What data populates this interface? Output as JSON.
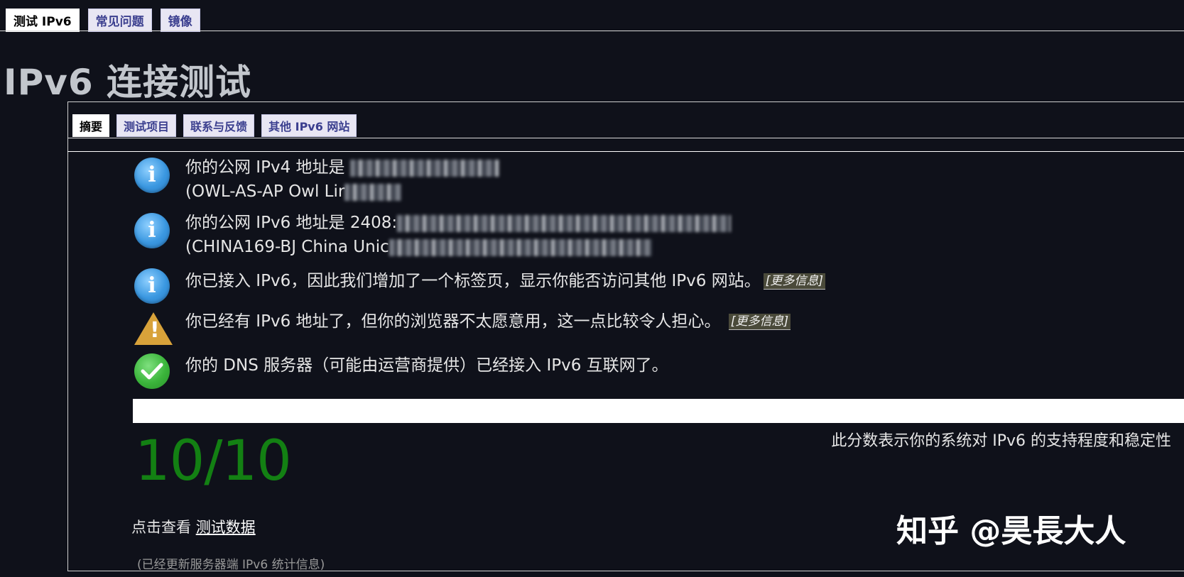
{
  "top_tabs": [
    {
      "label": "测试 IPv6",
      "active": true
    },
    {
      "label": "常见问题",
      "active": false
    },
    {
      "label": "镜像",
      "active": false
    }
  ],
  "page_title": "IPv6 连接测试",
  "sub_tabs": [
    {
      "label": "摘要",
      "active": true
    },
    {
      "label": "测试项目",
      "active": false
    },
    {
      "label": "联系与反馈",
      "active": false
    },
    {
      "label": "其他 IPv6 网站",
      "active": false
    }
  ],
  "info_rows": [
    {
      "icon": "info-icon",
      "line1": "你的公网 IPv4 地址是 ",
      "line2": "(OWL-AS-AP Owl Lir"
    },
    {
      "icon": "info-icon",
      "line1": "你的公网 IPv6 地址是 2408:",
      "line2": "(CHINA169-BJ China Unic"
    },
    {
      "icon": "info-icon",
      "text": "你已接入 IPv6，因此我们增加了一个标签页，显示你能否访问其他 IPv6 网站。",
      "link": "[更多信息]"
    },
    {
      "icon": "warning-icon",
      "text": "你已经有 IPv6 地址了，但你的浏览器不太愿意用，这一点比较令人担心。 ",
      "link": "[更多信息]"
    },
    {
      "icon": "check-icon",
      "text": "你的 DNS 服务器（可能由运营商提供）已经接入 IPv6 互联网了。"
    }
  ],
  "score": {
    "value": "10/10",
    "description": "此分数表示你的系统对 IPv6 的支持程度和稳定性",
    "color": "#138013"
  },
  "test_data": {
    "prefix": "点击查看 ",
    "link": "测试数据"
  },
  "updated_note": "(已经更新服务器端 IPv6 统计信息)",
  "watermark": "知乎 @昊長大人"
}
